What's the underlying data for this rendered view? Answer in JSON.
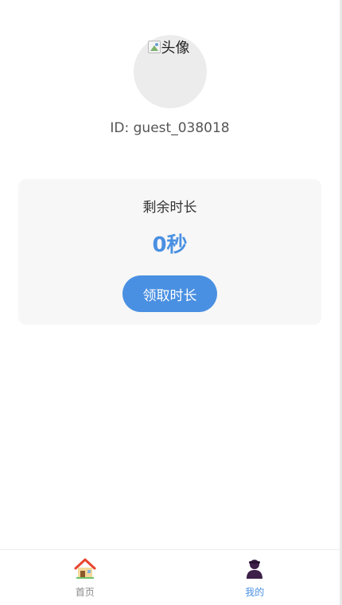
{
  "profile": {
    "avatar_alt": "头像",
    "user_id": "ID: guest_038018"
  },
  "balance_card": {
    "label": "剩余时长",
    "value": "0秒",
    "claim_button": "领取时长"
  },
  "tabbar": {
    "tabs": [
      {
        "label": "首页",
        "icon": "house-icon",
        "active": false
      },
      {
        "label": "我的",
        "icon": "person-icon",
        "active": true
      }
    ]
  },
  "colors": {
    "accent": "#4a90e2",
    "card_background": "#f7f7f7",
    "avatar_placeholder": "#ececec"
  }
}
